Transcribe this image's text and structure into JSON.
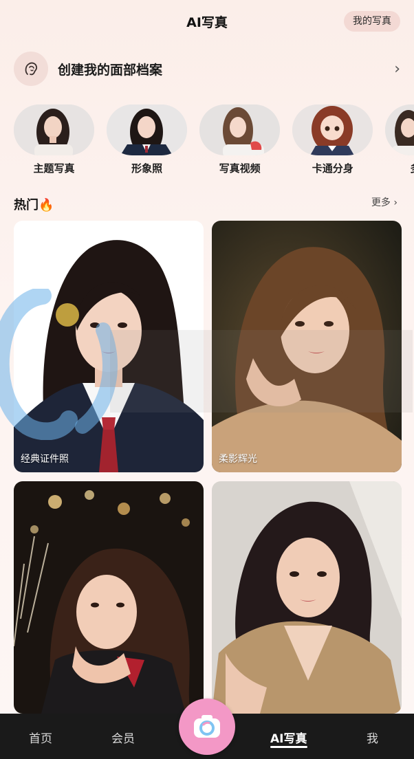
{
  "header": {
    "title": "AI写真",
    "my_photos_label": "我的写真"
  },
  "profile": {
    "label": "创建我的面部档案",
    "icon": "face-profile-icon"
  },
  "categories": [
    {
      "label": "主题写真"
    },
    {
      "label": "形象照"
    },
    {
      "label": "写真视频"
    },
    {
      "label": "卡通分身"
    },
    {
      "label": "多人写"
    }
  ],
  "section": {
    "title": "热门🔥",
    "more_label": "更多"
  },
  "cards": [
    {
      "caption": "经典证件照"
    },
    {
      "caption": "柔影辉光"
    },
    {
      "caption": ""
    },
    {
      "caption": ""
    }
  ],
  "tabbar": {
    "items": [
      {
        "label": "首页"
      },
      {
        "label": "会员"
      },
      {
        "label": "AI写真"
      },
      {
        "label": "我"
      }
    ],
    "active": "AI写真",
    "camera_icon": "camera-icon"
  },
  "colors": {
    "accent_pink": "#f398c6",
    "tabbar_bg": "#1a1a1a",
    "badge_bg": "#f3d9d4"
  }
}
